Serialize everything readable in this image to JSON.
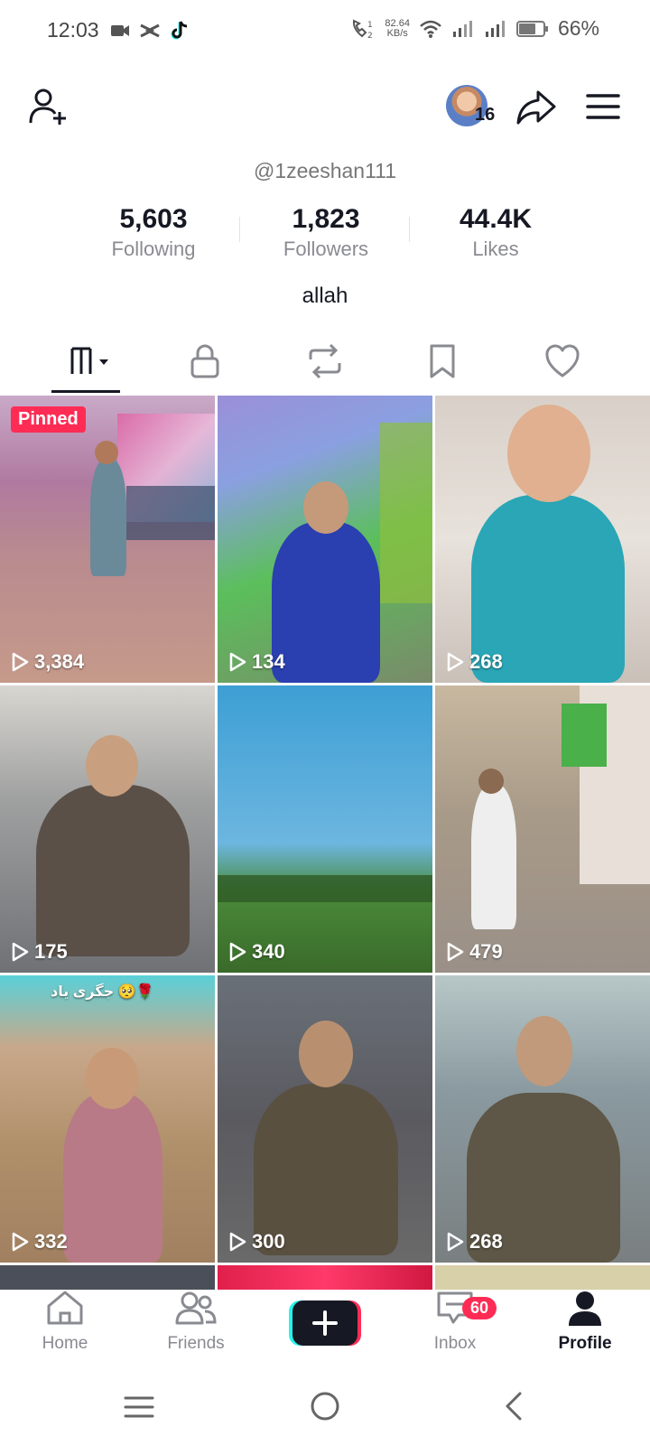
{
  "status_bar": {
    "time": "12:03",
    "net_speed_value": "82.64",
    "net_speed_unit": "KB/s",
    "battery": "66%"
  },
  "header": {
    "avatar_count": "16"
  },
  "profile": {
    "username": "@1zeeshan111",
    "bio": "allah",
    "stats": [
      {
        "value": "5,603",
        "label": "Following"
      },
      {
        "value": "1,823",
        "label": "Followers"
      },
      {
        "value": "44.4K",
        "label": "Likes"
      }
    ]
  },
  "tabs": [
    "videos-icon",
    "lock-icon",
    "repost-icon",
    "bookmark-icon",
    "heart-icon"
  ],
  "videos": [
    {
      "views": "3,384",
      "pinned": "Pinned"
    },
    {
      "views": "134"
    },
    {
      "views": "268"
    },
    {
      "views": "175"
    },
    {
      "views": "340"
    },
    {
      "views": "479"
    },
    {
      "views": "332",
      "caption": "جگری یاد 🥺🌹"
    },
    {
      "views": "300"
    },
    {
      "views": "268"
    }
  ],
  "bottom_nav": {
    "home": "Home",
    "friends": "Friends",
    "inbox": "Inbox",
    "inbox_badge": "60",
    "profile": "Profile"
  },
  "colors": {
    "accent": "#fe2c55",
    "cyan": "#25f4ee",
    "text": "#161823",
    "muted": "#8a8b91"
  }
}
